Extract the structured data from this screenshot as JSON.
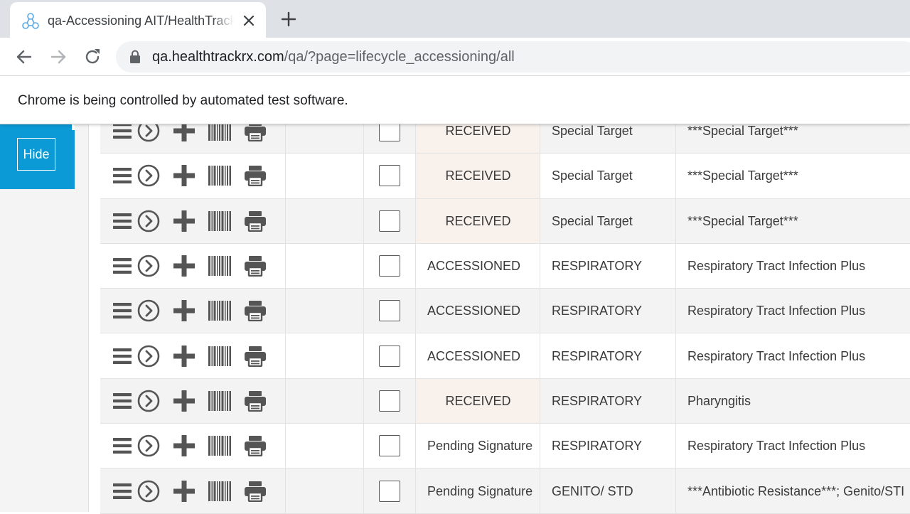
{
  "browser": {
    "tab": {
      "title": "qa-Accessioning AIT/HealthTrackRx"
    },
    "url": {
      "domain": "qa.healthtrackrx.com",
      "path": "/qa/?page=lifecycle_accessioning/all"
    },
    "infobar_text": "Chrome is being controlled by automated test software."
  },
  "sidebar": {
    "hide_label": "Hide"
  },
  "colors": {
    "accent_blue": "#0b9ad6",
    "received_bg": "#f9f1ec",
    "icon_gray": "#555555"
  },
  "row_icons": [
    "menu-icon",
    "go-icon",
    "add-icon",
    "barcode-icon",
    "print-icon"
  ],
  "rows": [
    {
      "status": "RECEIVED",
      "category": "Special Target",
      "panel": "***Special Target***"
    },
    {
      "status": "RECEIVED",
      "category": "Special Target",
      "panel": "***Special Target***"
    },
    {
      "status": "RECEIVED",
      "category": "Special Target",
      "panel": "***Special Target***"
    },
    {
      "status": "ACCESSIONED",
      "category": "RESPIRATORY",
      "panel": "Respiratory Tract Infection Plus"
    },
    {
      "status": "ACCESSIONED",
      "category": "RESPIRATORY",
      "panel": "Respiratory Tract Infection Plus"
    },
    {
      "status": "ACCESSIONED",
      "category": "RESPIRATORY",
      "panel": "Respiratory Tract Infection Plus"
    },
    {
      "status": "RECEIVED",
      "category": "RESPIRATORY",
      "panel": "Pharyngitis"
    },
    {
      "status": "Pending Signature",
      "category": "RESPIRATORY",
      "panel": "Respiratory Tract Infection Plus"
    },
    {
      "status": "Pending Signature",
      "category": "GENITO/ STD",
      "panel": "***Antibiotic Resistance***; Genito/STI"
    }
  ]
}
